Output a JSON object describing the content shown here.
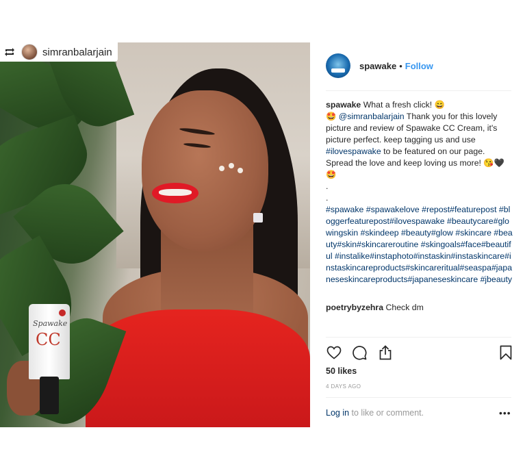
{
  "repost": {
    "icon": "repost-icon",
    "username": "simranbalarjain"
  },
  "post": {
    "author": "spawake",
    "separator": "•",
    "follow_label": "Follow",
    "caption": {
      "author": "spawake",
      "line1": "What a fresh click! 😄",
      "emoji_lead": "🤩",
      "mention": "@simranbalarjain",
      "text_a": " Thank you for this lovely picture and review of Spawake CC Cream, it's picture  perfect. keep tagging us and use ",
      "hashtag_inline": "#ilovespawake",
      "text_b": " to be featured on our page. Spread the love and keep loving us more! 😘🖤🤩",
      "dot1": ".",
      "dot2": ".",
      "hashtags": "#spawake #spawakelove #repost#featurepost #bloggerfeaturepost#ilovespawake #beautycare#glowingskin #skindeep #beauty#glow #skincare #beauty#skin#skincareroutine #skingoals#face#beautiful #instalike#instaphoto#instaskin#instaskincare#instaskincareproducts#skincareritual#seaspa#japaneseskincareproducts#japaneseskincare #jbeauty"
    },
    "comment": {
      "user": "poetrybyzehra",
      "text": "Check dm"
    },
    "likes": "50 likes",
    "age": "4 DAYS AGO",
    "login_link": "Log in",
    "login_text": " to like or comment.",
    "more": "•••"
  },
  "product": {
    "brand": "Spawake",
    "label": "CC"
  },
  "colors": {
    "link": "#3897f0",
    "hashtag": "#003569",
    "text": "#262626",
    "muted": "#999999"
  }
}
